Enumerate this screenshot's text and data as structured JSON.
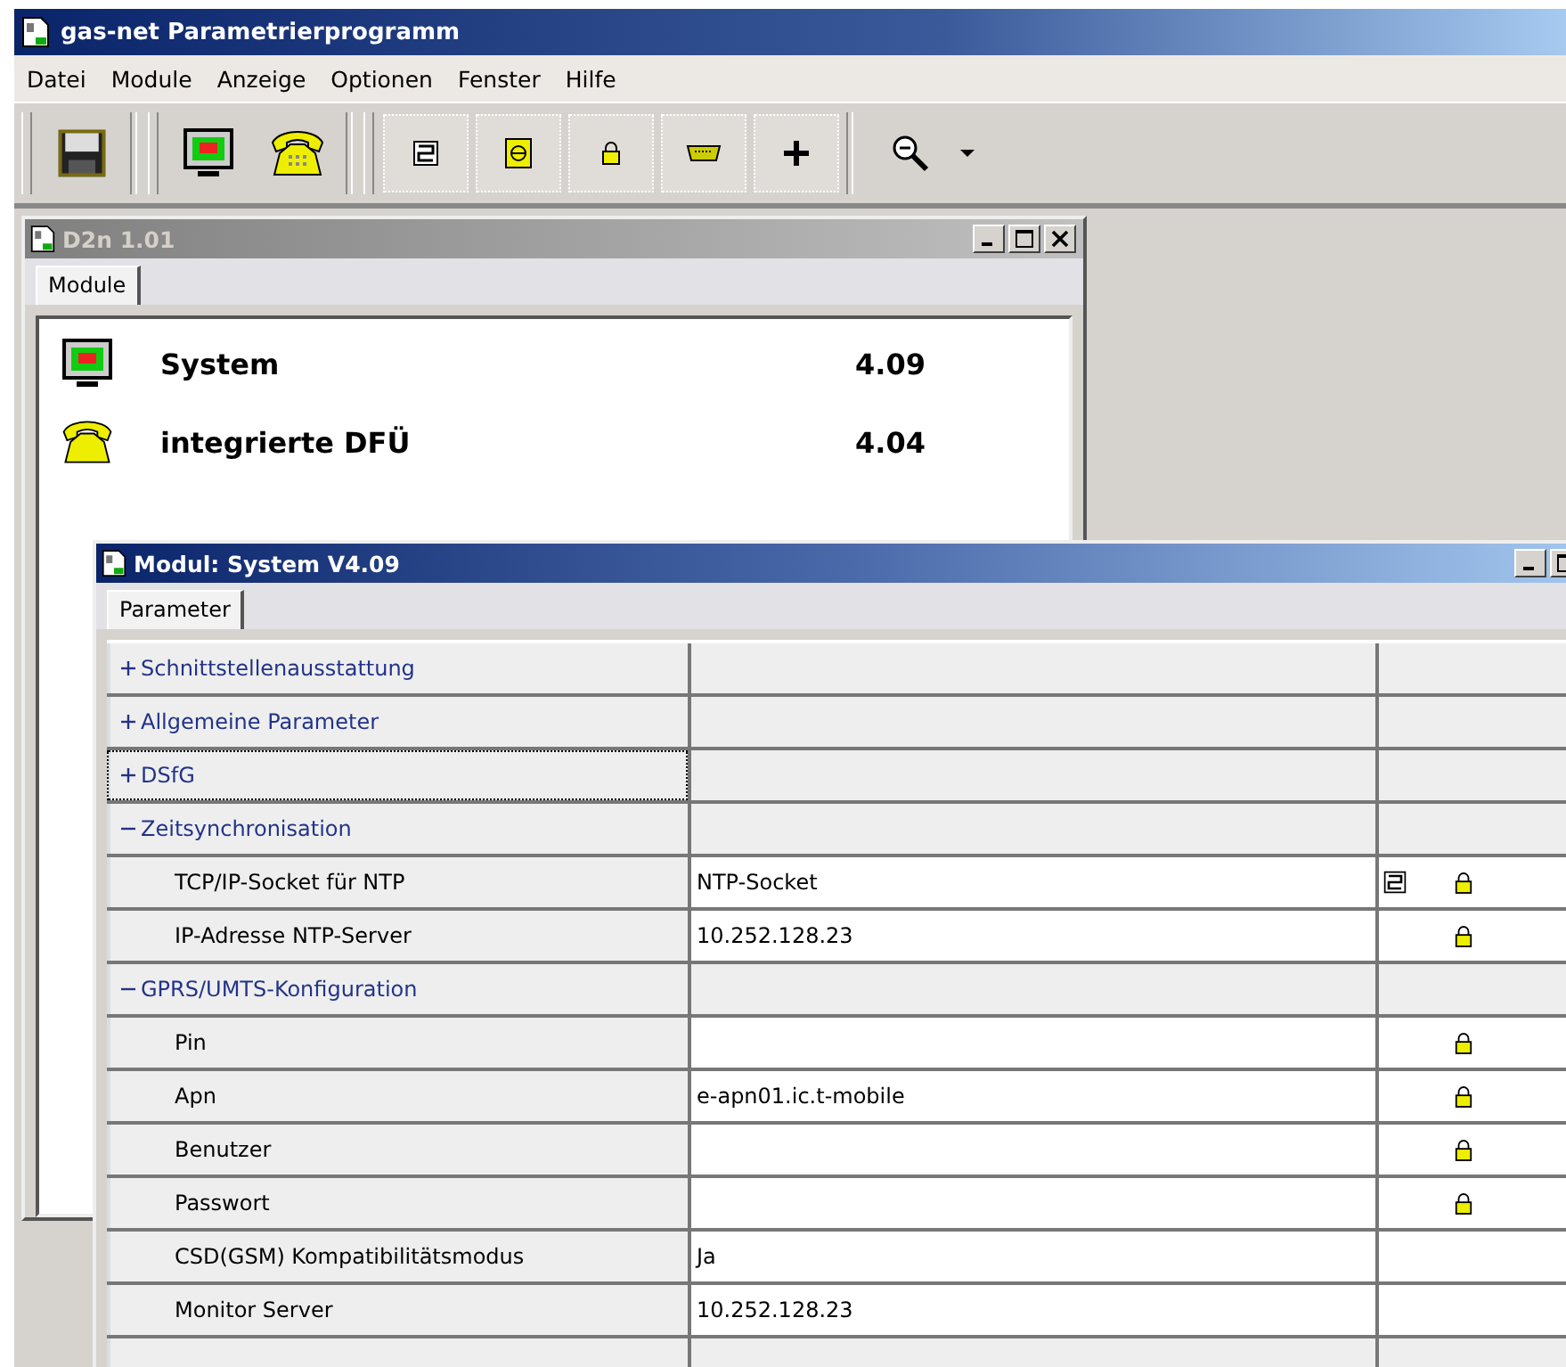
{
  "window": {
    "title": "gas-net Parametrierprogramm"
  },
  "menu": [
    "Datei",
    "Module",
    "Anzeige",
    "Optionen",
    "Fenster",
    "Hilfe"
  ],
  "module_window": {
    "title": "D2n 1.01",
    "active": false,
    "tabs": [
      "Module"
    ],
    "modules": [
      {
        "name": "System",
        "version": "4.09",
        "kind": "monitor"
      },
      {
        "name": "integrierte DFÜ",
        "version": "4.04",
        "kind": "phone"
      }
    ]
  },
  "parameter_window": {
    "title": "Modul: System V4.09",
    "active": true,
    "tabs": [
      "Parameter"
    ],
    "rows": [
      {
        "kind": "group",
        "label": "Schnittstellenausstattung",
        "expanded": false,
        "focused": false
      },
      {
        "kind": "group",
        "label": "Allgemeine Parameter",
        "expanded": false,
        "focused": false
      },
      {
        "kind": "group",
        "label": "DSfG",
        "expanded": false,
        "focused": true
      },
      {
        "kind": "group",
        "label": "Zeitsynchronisation",
        "expanded": true,
        "focused": false
      },
      {
        "kind": "param",
        "label": "TCP/IP-Socket für NTP",
        "value": "NTP-Socket",
        "linked": true,
        "locked": true,
        "focused": false
      },
      {
        "kind": "param",
        "label": "IP-Adresse NTP-Server",
        "value": "10.252.128.23",
        "linked": false,
        "locked": true,
        "focused": false
      },
      {
        "kind": "group",
        "label": "GPRS/UMTS-Konfiguration",
        "expanded": true,
        "focused": false
      },
      {
        "kind": "param",
        "label": "Pin",
        "linked": false,
        "locked": true,
        "focused": false
      },
      {
        "kind": "param",
        "label": "Apn",
        "value": "e-apn01.ic.t-mobile",
        "linked": false,
        "locked": true,
        "focused": false
      },
      {
        "kind": "param",
        "label": "Benutzer",
        "linked": false,
        "locked": true,
        "focused": false
      },
      {
        "kind": "param",
        "label": "Passwort",
        "linked": false,
        "locked": true,
        "focused": false
      },
      {
        "kind": "param",
        "label": "CSD(GSM) Kompatibilitätsmodus",
        "value": "Ja",
        "linked": false,
        "locked": false,
        "focused": false
      },
      {
        "kind": "param",
        "label": "Monitor Server",
        "value": "10.252.128.23",
        "linked": false,
        "locked": false,
        "focused": false
      }
    ]
  }
}
